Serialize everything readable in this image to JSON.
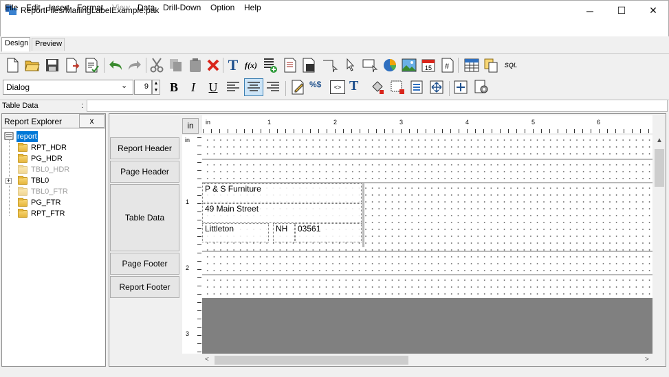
{
  "window": {
    "title": "ReportFiles/MailingLabelExample.pak",
    "minimize": "─",
    "maximize": "☐",
    "close": "✕"
  },
  "menu": [
    "File",
    "Edit",
    "Insert",
    "Format",
    "View",
    "Data",
    "Drill-Down",
    "Option",
    "Help"
  ],
  "menu_disabled": [
    "View"
  ],
  "tabs": [
    "Design",
    "Preview"
  ],
  "active_tab": "Design",
  "toolbar1": {
    "icons": [
      "new-icon",
      "open-icon",
      "save-icon",
      "export-icon",
      "publish-icon",
      "undo-icon",
      "redo-icon",
      "cut-icon",
      "copy-icon",
      "paste-icon",
      "delete-icon",
      "insert-label-icon",
      "insert-formula-icon",
      "insert-column-icon",
      "insert-subreport-icon",
      "insert-image-icon",
      "insert-line-icon",
      "select-pointer-icon",
      "insert-rectangle-icon",
      "insert-chart-icon",
      "insert-picture-icon",
      "insert-date-icon",
      "insert-page-number-icon",
      "table-icon",
      "clipboard-icon",
      "sql-icon"
    ],
    "sql_label": "SQL",
    "formula_label": "f(x)",
    "label_letter": "T",
    "date_day": "15",
    "page_hash": "#"
  },
  "toolbar2": {
    "font": "Dialog",
    "font_size": "9",
    "bold": "B",
    "italic": "I",
    "underline": "U",
    "percent_dollar": "%$",
    "code": "<>"
  },
  "table_data_bar": {
    "label": "Table Data",
    "colon": ":"
  },
  "explorer": {
    "title": "Report Explorer",
    "close": "x",
    "tree": [
      {
        "label": "report",
        "root": true
      },
      {
        "label": "RPT_HDR",
        "enabled": true
      },
      {
        "label": "PG_HDR",
        "enabled": true
      },
      {
        "label": "TBL0_HDR",
        "enabled": false
      },
      {
        "label": "TBL0",
        "enabled": true,
        "expander": "+"
      },
      {
        "label": "TBL0_FTR",
        "enabled": false
      },
      {
        "label": "PG_FTR",
        "enabled": true
      },
      {
        "label": "RPT_FTR",
        "enabled": true
      }
    ]
  },
  "designer": {
    "unit": "in",
    "ruler_label": "in",
    "h_ticks": [
      "1",
      "2",
      "3",
      "4",
      "5",
      "6"
    ],
    "v_ticks": [
      "1",
      "2",
      "3"
    ],
    "bands": [
      "Report Header",
      "Page Header",
      "Table Data",
      "Page Footer",
      "Report Footer"
    ],
    "fields": {
      "company": "P & S Furniture",
      "street": "49 Main Street",
      "city": "Littleton",
      "state": "NH",
      "zip": "03561"
    }
  },
  "colors": {
    "gray_area": "#808080",
    "selection": "#0078d7"
  }
}
